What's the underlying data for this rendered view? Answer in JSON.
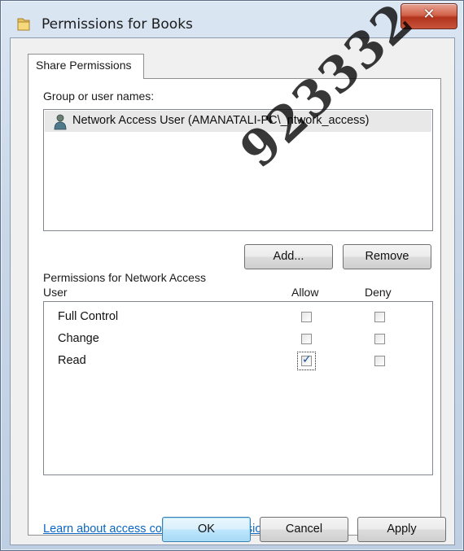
{
  "window": {
    "title": "Permissions for Books",
    "close_glyph": "✕"
  },
  "tab": {
    "label": "Share Permissions"
  },
  "group_label": "Group or user names:",
  "users": [
    {
      "name": "Network Access User (AMANATALI-PC\\_ntwork_access)",
      "icon": "user-icon"
    }
  ],
  "buttons": {
    "add": "Add...",
    "remove": "Remove",
    "ok": "OK",
    "cancel": "Cancel",
    "apply": "Apply"
  },
  "permissions": {
    "label_line1": "Permissions for Network Access",
    "label_line2": "User",
    "col_allow": "Allow",
    "col_deny": "Deny",
    "rows": [
      {
        "name": "Full Control",
        "allow": false,
        "deny": false
      },
      {
        "name": "Change",
        "allow": false,
        "deny": false
      },
      {
        "name": "Read",
        "allow": true,
        "deny": false
      }
    ],
    "check_glyph": "✓"
  },
  "link": "Learn about access control and permissions",
  "watermark": "923332",
  "colors": {
    "link": "#0a66c2",
    "close_button": "#c8543b",
    "default_button": "#bee6fd",
    "selected_row": "#e8e8e8"
  }
}
